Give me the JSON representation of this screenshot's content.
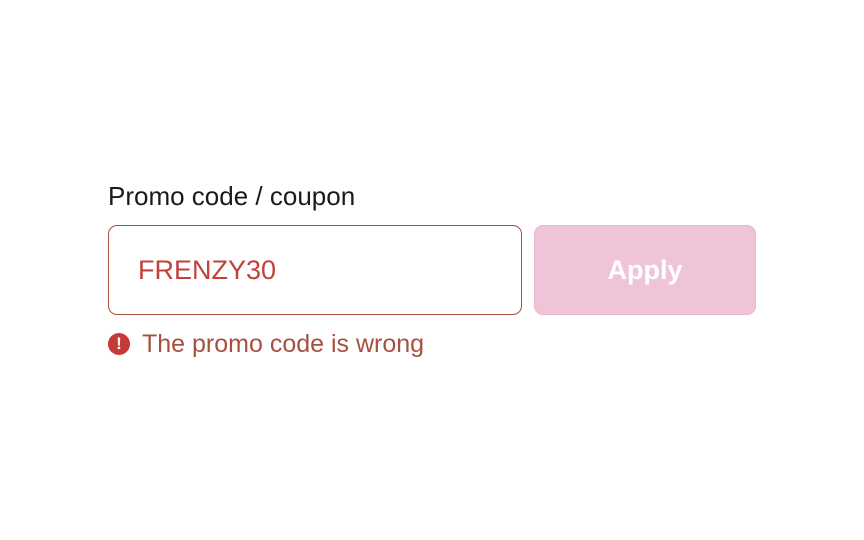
{
  "promo": {
    "label": "Promo code / coupon",
    "input_value": "FRENZY30",
    "apply_label": "Apply",
    "error_icon": "!",
    "error_message": "The promo code is wrong"
  },
  "colors": {
    "error": "#c43a36",
    "error_text": "#a8503f",
    "input_text": "#c2413b",
    "button_disabled_bg": "#f0c4d8",
    "button_text": "#ffffff"
  },
  "icons": {
    "error": "error-exclamation-icon"
  }
}
